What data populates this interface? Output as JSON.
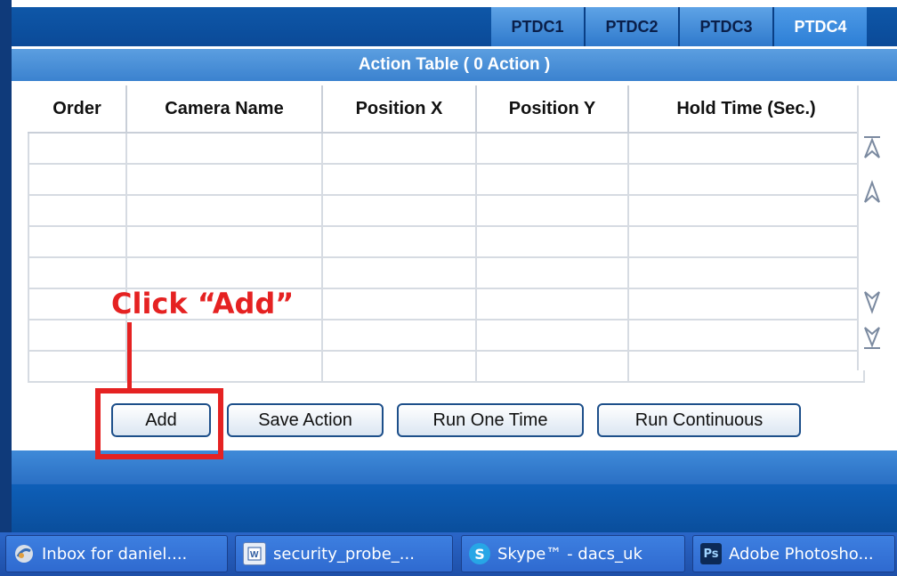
{
  "tabs": [
    "PTDC1",
    "PTDC2",
    "PTDC3",
    "PTDC4"
  ],
  "active_tab": "PTDC4",
  "action_table": {
    "title": "Action Table  ( 0 Action )",
    "columns": [
      "Order",
      "Camera Name",
      "Position X",
      "Position Y",
      "Hold Time (Sec.)"
    ],
    "row_count": 8
  },
  "scroll_icons": [
    "scroll-top-icon",
    "scroll-up-icon",
    "scroll-down-icon",
    "scroll-bottom-icon"
  ],
  "buttons": {
    "add": "Add",
    "save_action": "Save Action",
    "run_one_time": "Run One Time",
    "run_continuous": "Run Continuous"
  },
  "annotation": {
    "text": "Click “Add”",
    "color": "#e52222"
  },
  "taskbar": [
    {
      "label": "Inbox for daniel....",
      "icon": "mail-icon"
    },
    {
      "label": "security_probe_...",
      "icon": "word-doc-icon"
    },
    {
      "label": "Skype™ - dacs_uk",
      "icon": "skype-icon"
    },
    {
      "label": "Adobe Photosho...",
      "icon": "photoshop-icon",
      "icon_text": "Ps"
    }
  ]
}
